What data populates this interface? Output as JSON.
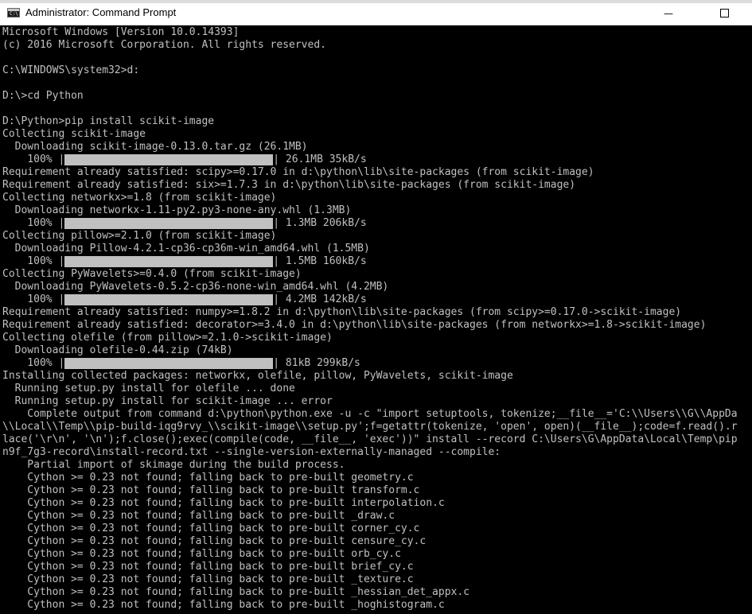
{
  "window": {
    "title": "Administrator: Command Prompt",
    "icon": "cmd-icon",
    "minimize_glyph": "—"
  },
  "console": {
    "lines": [
      "Microsoft Windows [Version 10.0.14393]",
      "(c) 2016 Microsoft Corporation. All rights reserved.",
      "",
      "C:\\WINDOWS\\system32>d:",
      "",
      "D:\\>cd Python",
      "",
      "D:\\Python>pip install scikit-image",
      "Collecting scikit-image",
      "  Downloading scikit-image-0.13.0.tar.gz (26.1MB)",
      {
        "progress": "    100% |",
        "progress_fraction": 1.0,
        "after": "| 26.1MB 35kB/s"
      },
      "Requirement already satisfied: scipy>=0.17.0 in d:\\python\\lib\\site-packages (from scikit-image)",
      "Requirement already satisfied: six>=1.7.3 in d:\\python\\lib\\site-packages (from scikit-image)",
      "Collecting networkx>=1.8 (from scikit-image)",
      "  Downloading networkx-1.11-py2.py3-none-any.whl (1.3MB)",
      {
        "progress": "    100% |",
        "progress_fraction": 1.0,
        "after": "| 1.3MB 206kB/s"
      },
      "Collecting pillow>=2.1.0 (from scikit-image)",
      "  Downloading Pillow-4.2.1-cp36-cp36m-win_amd64.whl (1.5MB)",
      {
        "progress": "    100% |",
        "progress_fraction": 1.0,
        "after": "| 1.5MB 160kB/s"
      },
      "Collecting PyWavelets>=0.4.0 (from scikit-image)",
      "  Downloading PyWavelets-0.5.2-cp36-none-win_amd64.whl (4.2MB)",
      {
        "progress": "    100% |",
        "progress_fraction": 1.0,
        "after": "| 4.2MB 142kB/s"
      },
      "Requirement already satisfied: numpy>=1.8.2 in d:\\python\\lib\\site-packages (from scipy>=0.17.0->scikit-image)",
      "Requirement already satisfied: decorator>=3.4.0 in d:\\python\\lib\\site-packages (from networkx>=1.8->scikit-image)",
      "Collecting olefile (from pillow>=2.1.0->scikit-image)",
      "  Downloading olefile-0.44.zip (74kB)",
      {
        "progress": "    100% |",
        "progress_fraction": 1.0,
        "after": "| 81kB 299kB/s"
      },
      "Installing collected packages: networkx, olefile, pillow, PyWavelets, scikit-image",
      "  Running setup.py install for olefile ... done",
      "  Running setup.py install for scikit-image ... error",
      "    Complete output from command d:\\python\\python.exe -u -c \"import setuptools, tokenize;__file__='C:\\\\Users\\\\G\\\\AppDa",
      "\\\\Local\\\\Temp\\\\pip-build-iqg9rvy_\\\\scikit-image\\\\setup.py';f=getattr(tokenize, 'open', open)(__file__);code=f.read().r",
      "lace('\\r\\n', '\\n');f.close();exec(compile(code, __file__, 'exec'))\" install --record C:\\Users\\G\\AppData\\Local\\Temp\\pip",
      "n9f_7g3-record\\install-record.txt --single-version-externally-managed --compile:",
      "    Partial import of skimage during the build process.",
      "    Cython >= 0.23 not found; falling back to pre-built geometry.c",
      "    Cython >= 0.23 not found; falling back to pre-built transform.c",
      "    Cython >= 0.23 not found; falling back to pre-built interpolation.c",
      "    Cython >= 0.23 not found; falling back to pre-built _draw.c",
      "    Cython >= 0.23 not found; falling back to pre-built corner_cy.c",
      "    Cython >= 0.23 not found; falling back to pre-built censure_cy.c",
      "    Cython >= 0.23 not found; falling back to pre-built orb_cy.c",
      "    Cython >= 0.23 not found; falling back to pre-built brief_cy.c",
      "    Cython >= 0.23 not found; falling back to pre-built _texture.c",
      "    Cython >= 0.23 not found; falling back to pre-built _hessian_det_appx.c",
      "    Cython >= 0.23 not found; falling back to pre-built _hoghistogram.c"
    ]
  },
  "colors": {
    "console_bg": "#000000",
    "console_text": "#c0c0c0",
    "titlebar_bg": "#ffffff"
  }
}
